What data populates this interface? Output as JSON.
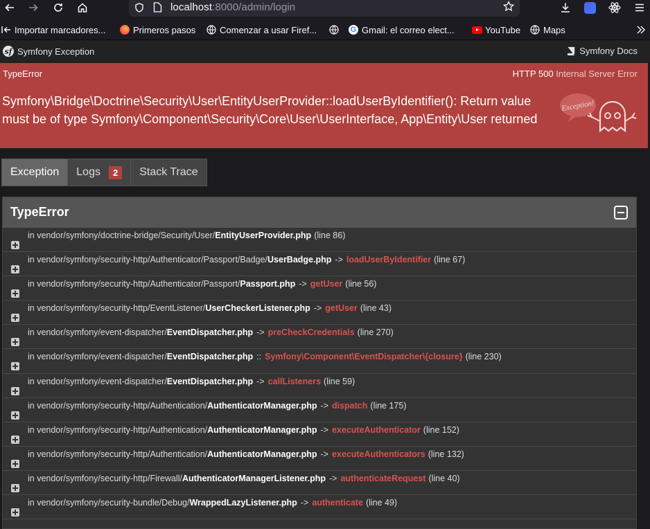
{
  "browser": {
    "url_host": "localhost",
    "url_rest": ":8000/admin/login",
    "bookmarks": [
      {
        "label": "Importar marcadores...",
        "icon": "import-icon"
      },
      {
        "label": "Primeros pasos",
        "icon": "firefox-icon"
      },
      {
        "label": "Comenzar a usar Firef...",
        "icon": "globe-icon"
      },
      {
        "label": "",
        "icon": "globe-icon"
      },
      {
        "label": "Gmail: el correo elect...",
        "icon": "google-icon"
      },
      {
        "label": "YouTube",
        "icon": "youtube-icon"
      },
      {
        "label": "Maps",
        "icon": "globe-icon"
      }
    ]
  },
  "symfony": {
    "brand": "Symfony Exception",
    "docs": "Symfony Docs"
  },
  "banner": {
    "exception_class": "TypeError",
    "status_code": "HTTP 500",
    "status_text": "Internal Server Error",
    "message": "Symfony\\Bridge\\Doctrine\\Security\\User\\EntityUserProvider::loadUserByIdentifier(): Return value must be of type Symfony\\Component\\Security\\Core\\User\\UserInterface, App\\Entity\\User returned",
    "ghost_text": "Exception!"
  },
  "tabs": [
    {
      "label": "Exception"
    },
    {
      "label": "Logs",
      "count": "2"
    },
    {
      "label": "Stack Trace"
    }
  ],
  "trace": {
    "title": "TypeError",
    "rows": [
      {
        "path": "in vendor/symfony/doctrine-bridge/Security/User/",
        "file": "EntityUserProvider.php",
        "op": "",
        "fn": "",
        "line": "(line 86)"
      },
      {
        "path": "in vendor/symfony/security-http/Authenticator/Passport/Badge/",
        "file": "UserBadge.php",
        "op": "->",
        "fn": "loadUserByIdentifier",
        "line": "(line 67)"
      },
      {
        "path": "in vendor/symfony/security-http/Authenticator/Passport/",
        "file": "Passport.php",
        "op": "->",
        "fn": "getUser",
        "line": "(line 56)"
      },
      {
        "path": "in vendor/symfony/security-http/EventListener/",
        "file": "UserCheckerListener.php",
        "op": "->",
        "fn": "getUser",
        "line": "(line 43)"
      },
      {
        "path": "in vendor/symfony/event-dispatcher/",
        "file": "EventDispatcher.php",
        "op": "->",
        "fn": "preCheckCredentials",
        "line": "(line 270)"
      },
      {
        "path": "in vendor/symfony/event-dispatcher/",
        "file": "EventDispatcher.php",
        "op": "::",
        "fn": "Symfony\\Component\\EventDispatcher\\{closure}",
        "line": "(line 230)"
      },
      {
        "path": "in vendor/symfony/event-dispatcher/",
        "file": "EventDispatcher.php",
        "op": "->",
        "fn": "callListeners",
        "line": "(line 59)"
      },
      {
        "path": "in vendor/symfony/security-http/Authentication/",
        "file": "AuthenticatorManager.php",
        "op": "->",
        "fn": "dispatch",
        "line": "(line 175)"
      },
      {
        "path": "in vendor/symfony/security-http/Authentication/",
        "file": "AuthenticatorManager.php",
        "op": "->",
        "fn": "executeAuthenticator",
        "line": "(line 152)"
      },
      {
        "path": "in vendor/symfony/security-http/Authentication/",
        "file": "AuthenticatorManager.php",
        "op": "->",
        "fn": "executeAuthenticators",
        "line": "(line 132)"
      },
      {
        "path": "in vendor/symfony/security-http/Firewall/",
        "file": "AuthenticatorManagerListener.php",
        "op": "->",
        "fn": "authenticateRequest",
        "line": "(line 40)"
      },
      {
        "path": "in vendor/symfony/security-bundle/Debug/",
        "file": "WrappedLazyListener.php",
        "op": "->",
        "fn": "authenticate",
        "line": "(line 49)"
      }
    ]
  },
  "colors": {
    "banner_bg": "#b0413e",
    "function_red": "#d9534f"
  }
}
